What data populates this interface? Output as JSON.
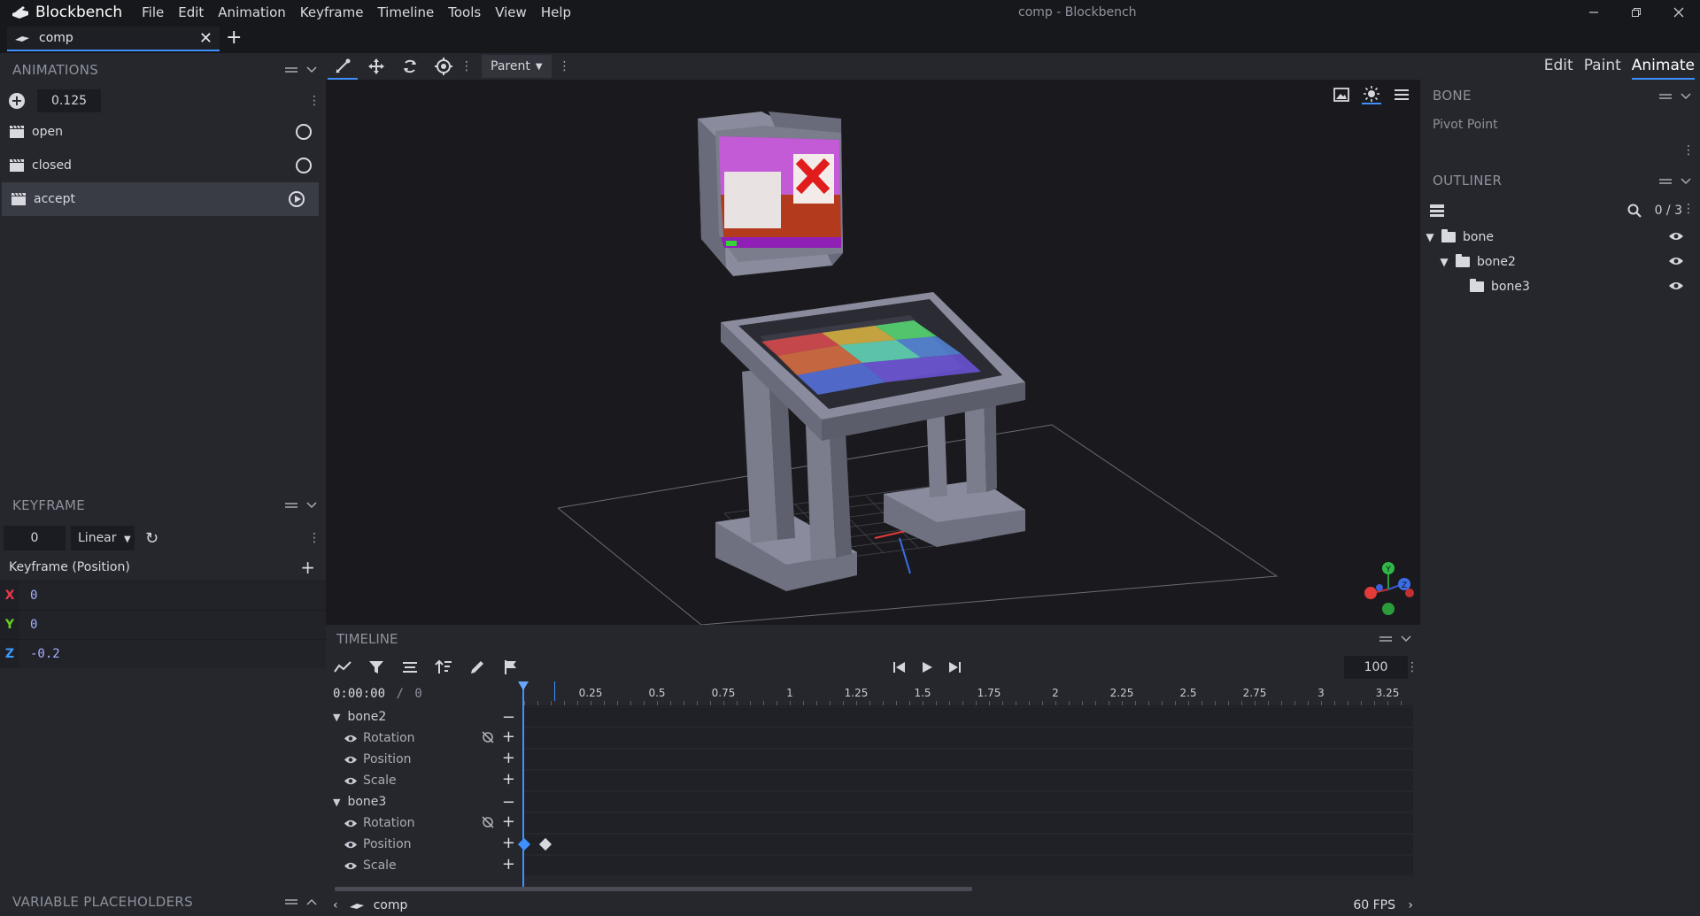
{
  "app": {
    "name": "Blockbench",
    "window_title": "comp - Blockbench",
    "menu": [
      "File",
      "Edit",
      "Animation",
      "Keyframe",
      "Timeline",
      "Tools",
      "View",
      "Help"
    ]
  },
  "tab": {
    "label": "comp"
  },
  "modes": {
    "edit": "Edit",
    "paint": "Paint",
    "animate": "Animate",
    "active": "Animate"
  },
  "toolbar": {
    "parent_label": "Parent"
  },
  "animations_panel": {
    "title": "ANIMATIONS",
    "value": "0.125",
    "items": [
      {
        "label": "open",
        "state": "idle"
      },
      {
        "label": "closed",
        "state": "idle"
      },
      {
        "label": "accept",
        "state": "playing"
      }
    ]
  },
  "keyframe_panel": {
    "title": "KEYFRAME",
    "time": "0",
    "interpolation": "Linear",
    "channel_title": "Keyframe (Position)",
    "axes": [
      {
        "label": "X",
        "value": "0",
        "color": "#e8374b"
      },
      {
        "label": "Y",
        "value": "0",
        "color": "#65d31f"
      },
      {
        "label": "Z",
        "value": "-0.2",
        "color": "#3b9bff"
      }
    ]
  },
  "variable_placeholders": {
    "title": "VARIABLE PLACEHOLDERS"
  },
  "bone_panel": {
    "title": "BONE",
    "pivot_label": "Pivot Point"
  },
  "outliner": {
    "title": "OUTLINER",
    "count": "0 / 3",
    "items": [
      {
        "label": "bone"
      },
      {
        "label": "bone2"
      },
      {
        "label": "bone3"
      }
    ]
  },
  "timeline": {
    "title": "TIMELINE",
    "current_time": "0:00:00",
    "separator": "/",
    "total": "0",
    "speed": "100",
    "ticks": [
      "0.25",
      "0.5",
      "0.75",
      "1",
      "1.25",
      "1.5",
      "1.75",
      "2",
      "2.25",
      "2.5",
      "2.75",
      "3",
      "3.25"
    ],
    "groups": [
      {
        "name": "bone2",
        "channels": [
          "Rotation",
          "Position",
          "Scale"
        ]
      },
      {
        "name": "bone3",
        "channels": [
          "Rotation",
          "Position",
          "Scale"
        ]
      }
    ],
    "footer_label": "comp",
    "fps": "60 FPS"
  },
  "colors": {
    "accent": "#3e90ff",
    "panel": "#26272d",
    "viewport": "#1a1a1e"
  }
}
